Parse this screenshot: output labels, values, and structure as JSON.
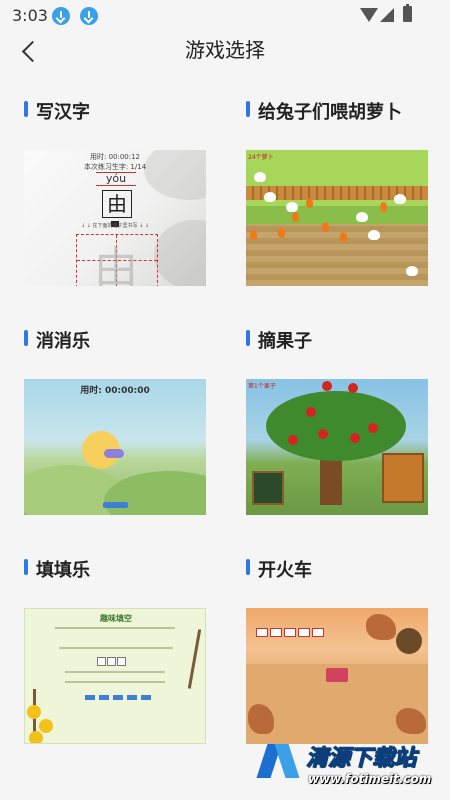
{
  "status_bar": {
    "time": "3:03",
    "icons": [
      "download-icon",
      "download-icon",
      "wifi-icon",
      "signal-icon",
      "battery-icon"
    ]
  },
  "header": {
    "back_icon": "chevron-left-icon",
    "title": "游戏选择"
  },
  "accent_color": "#2c78e4",
  "games": [
    {
      "title": "写汉字",
      "preview": {
        "timer": "用时:  00:00:12",
        "progress": "本次练习生字:  1/14",
        "pinyin": "yóu",
        "character": "由",
        "hint": "↓ ↓ 在下面的格子里书写 ↓ ↓"
      }
    },
    {
      "title": "给兔子们喂胡萝卜",
      "preview": {
        "score": "24个萝卜"
      }
    },
    {
      "title": "消消乐",
      "preview": {
        "timer": "用时:  00:00:00"
      }
    },
    {
      "title": "摘果子",
      "preview": {
        "level": "第1个果子"
      }
    },
    {
      "title": "填填乐",
      "preview": {
        "title": "趣味填空"
      }
    },
    {
      "title": "开火车"
    }
  ],
  "watermark": {
    "text": "清源下载站",
    "url": "www.fotimeit.com"
  }
}
